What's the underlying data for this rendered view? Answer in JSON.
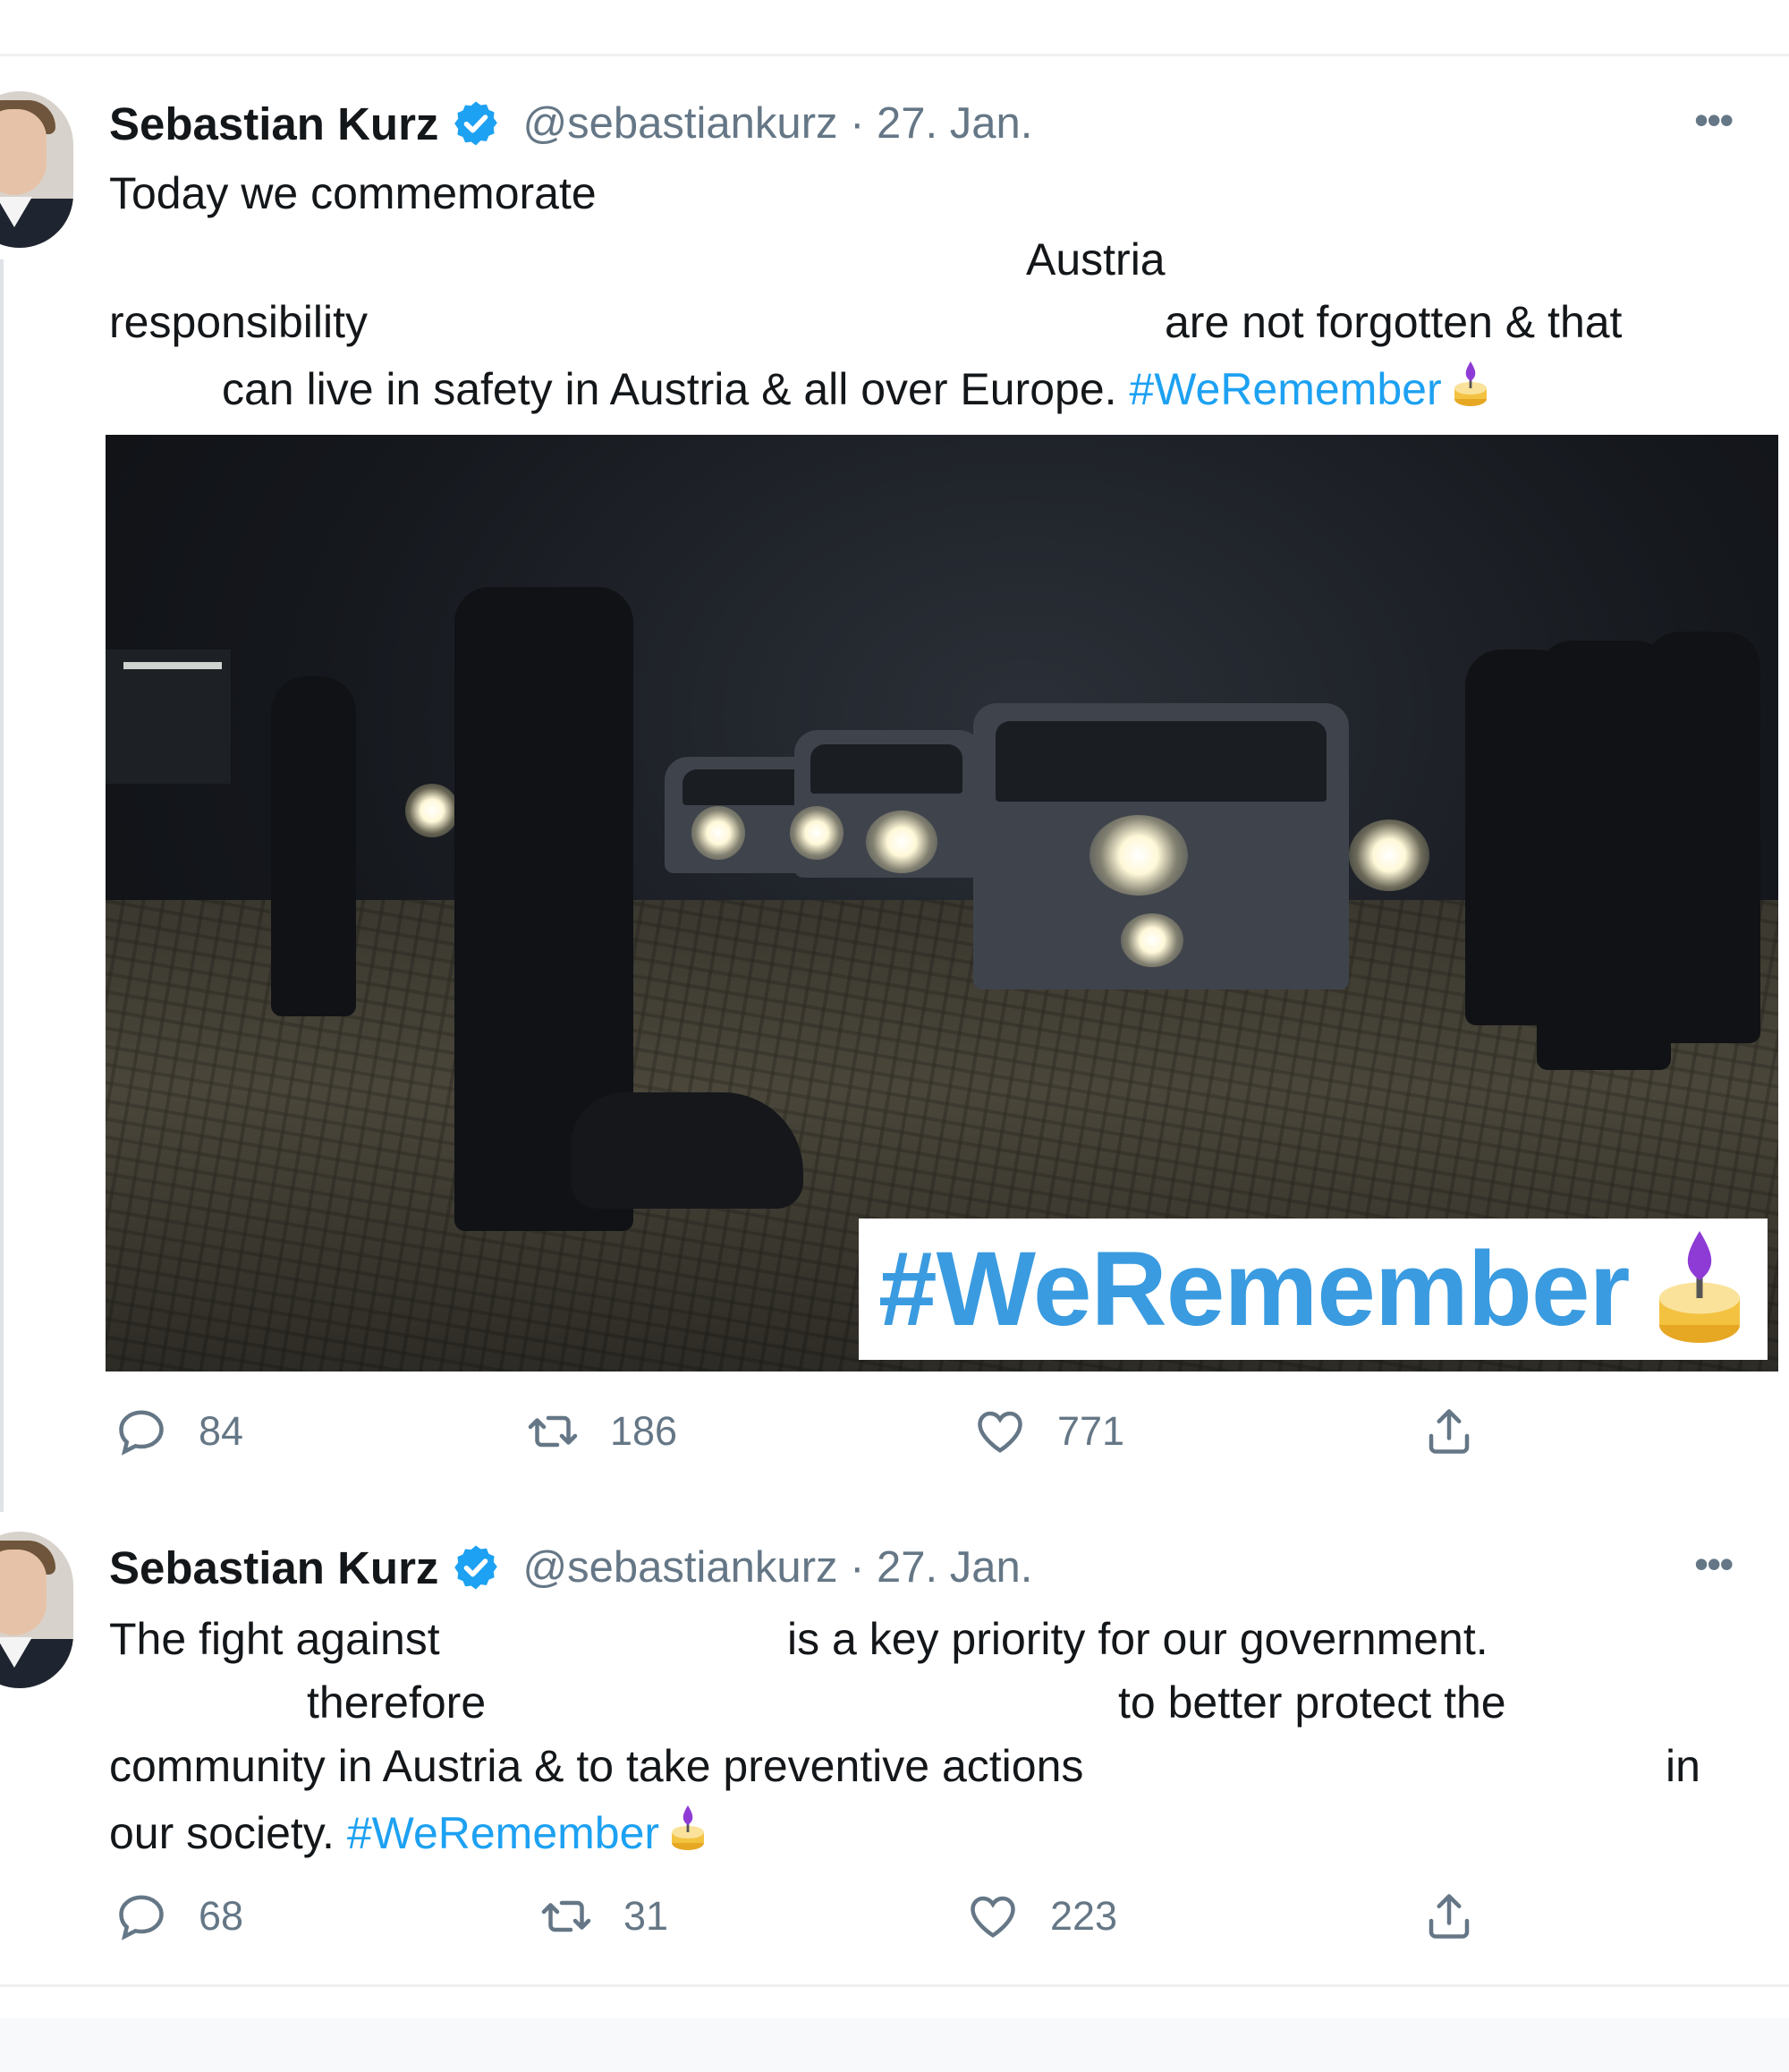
{
  "tweets": [
    {
      "author": "Sebastian Kurz",
      "handle_date": "@sebastiankurz · 27. Jan.",
      "lines": [
        {
          "text": "Today we commemorate"
        },
        {
          "text": "Austria"
        },
        {
          "text": "responsibility"
        },
        {
          "text": "are not forgotten & that"
        },
        {
          "text": "can live in safety in Austria & all over Europe.",
          "hashtag": "#WeRemember"
        }
      ],
      "media": {
        "overlay_hashtag": "#WeRemember"
      },
      "actions": {
        "replies": "84",
        "retweets": "186",
        "likes": "771"
      }
    },
    {
      "author": "Sebastian Kurz",
      "handle_date": "@sebastiankurz · 27. Jan.",
      "lines": [
        {
          "text": "The fight against"
        },
        {
          "text": "is a key priority for our government."
        },
        {
          "text": "therefore"
        },
        {
          "text": "to better protect the"
        },
        {
          "text": "community in Austria & to take preventive actions"
        },
        {
          "text": "in"
        },
        {
          "text": "our society.",
          "hashtag": "#WeRemember"
        }
      ],
      "actions": {
        "replies": "68",
        "retweets": "31",
        "likes": "223"
      }
    }
  ],
  "icons": {
    "verified": "verified-badge-icon",
    "more": "more-options-icon",
    "candle": "candle-emoji-icon",
    "reply": "reply-icon",
    "retweet": "retweet-icon",
    "like": "heart-icon",
    "share": "share-icon"
  },
  "colors": {
    "accent": "#1da1f2",
    "muted": "#657786",
    "text": "#14171a",
    "candle_flame": "#8e3bd6",
    "candle_base": "#f3c241"
  }
}
